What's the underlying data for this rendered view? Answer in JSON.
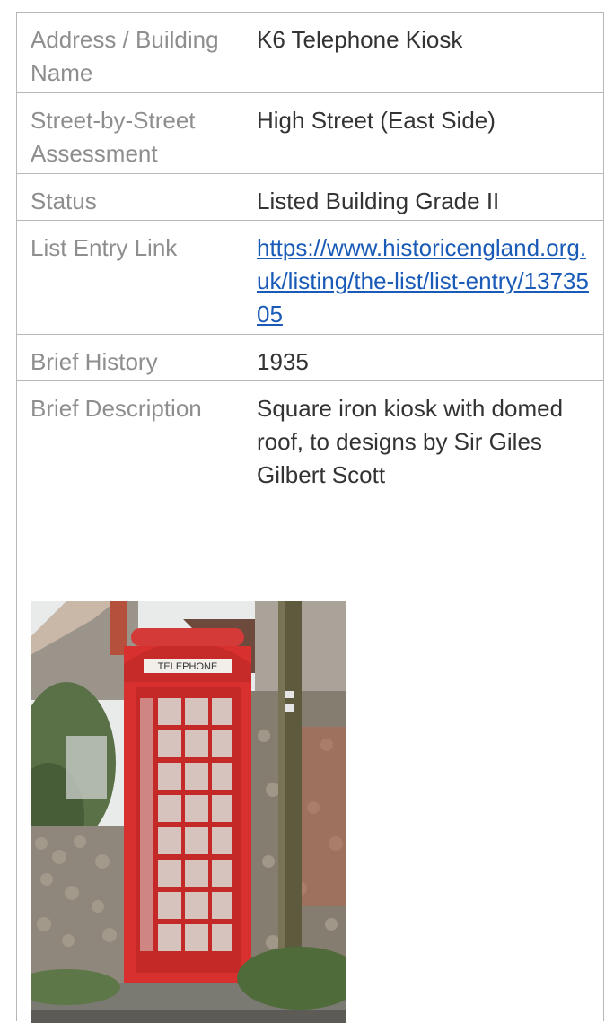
{
  "rows": [
    {
      "label": "Address / Building Name",
      "value": "K6 Telephone Kiosk"
    },
    {
      "label": "Street-by-Street Assessment",
      "value": "High Street (East Side)"
    },
    {
      "label": "Status",
      "value": "Listed Building Grade II"
    },
    {
      "label": "List Entry Link",
      "value": "https://www.historicengland.org.uk/listing/the-list/list-entry/1373505"
    },
    {
      "label": "Brief History",
      "value": "1935"
    },
    {
      "label": "Brief Description",
      "value": "Square iron kiosk with domed roof, to designs by Sir Giles Gilbert Scott"
    }
  ],
  "photo": {
    "sign_text": "TELEPHONE",
    "colors": {
      "kiosk_red": "#d8302f",
      "sky": "#eef0ef",
      "flint_wall": "#8c8578",
      "foliage": "#4f6b3a"
    }
  }
}
